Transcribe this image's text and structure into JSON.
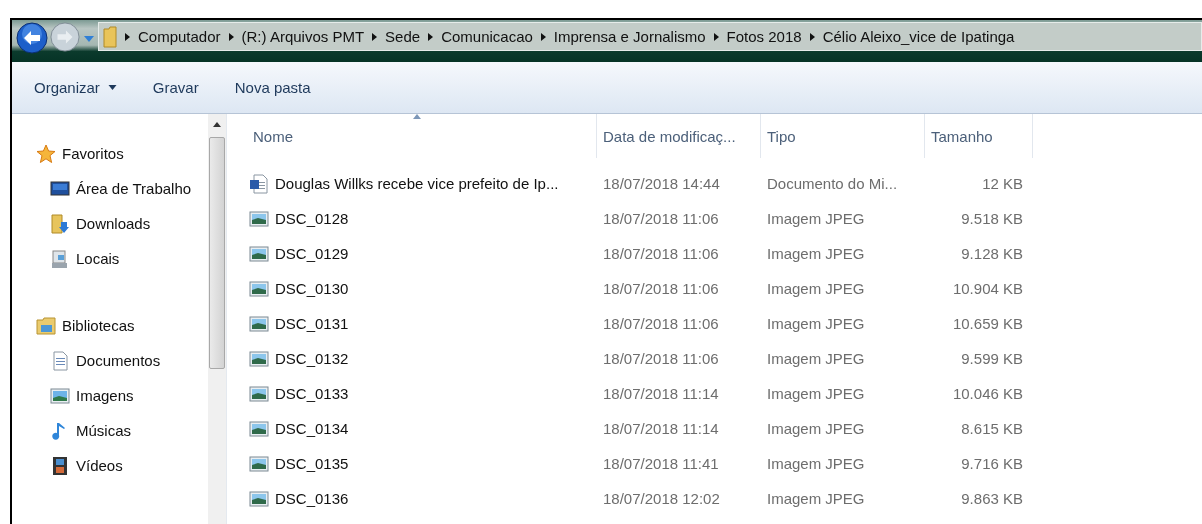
{
  "breadcrumb": [
    "Computador",
    "(R:) Arquivos  PMT",
    "Sede",
    "Comunicacao",
    "Imprensa e Jornalismo",
    "Fotos 2018",
    "Célio Aleixo_vice de Ipatinga"
  ],
  "toolbar": [
    {
      "label": "Organizar",
      "dropdown": true
    },
    {
      "label": "Gravar",
      "dropdown": false
    },
    {
      "label": "Nova pasta",
      "dropdown": false
    }
  ],
  "sidebar": [
    {
      "label": "Favoritos",
      "kind": "star",
      "children": [
        {
          "label": "Área de Trabalho",
          "kind": "desktop"
        },
        {
          "label": "Downloads",
          "kind": "downloads"
        },
        {
          "label": "Locais",
          "kind": "places"
        }
      ]
    },
    {
      "label": "Bibliotecas",
      "kind": "library",
      "children": [
        {
          "label": "Documentos",
          "kind": "documents"
        },
        {
          "label": "Imagens",
          "kind": "images"
        },
        {
          "label": "Músicas",
          "kind": "music"
        },
        {
          "label": "Vídeos",
          "kind": "videos"
        }
      ]
    }
  ],
  "columns": [
    "Nome",
    "Data de modificaç...",
    "Tipo",
    "Tamanho"
  ],
  "rows": [
    {
      "name": "Douglas Willks recebe vice prefeito de Ip...",
      "kind": "word",
      "date": "18/07/2018 14:44",
      "type": "Documento do Mi...",
      "size": "12 KB"
    },
    {
      "name": "DSC_0128",
      "kind": "image",
      "date": "18/07/2018 11:06",
      "type": "Imagem JPEG",
      "size": "9.518 KB"
    },
    {
      "name": "DSC_0129",
      "kind": "image",
      "date": "18/07/2018 11:06",
      "type": "Imagem JPEG",
      "size": "9.128 KB"
    },
    {
      "name": "DSC_0130",
      "kind": "image",
      "date": "18/07/2018 11:06",
      "type": "Imagem JPEG",
      "size": "10.904 KB"
    },
    {
      "name": "DSC_0131",
      "kind": "image",
      "date": "18/07/2018 11:06",
      "type": "Imagem JPEG",
      "size": "10.659 KB"
    },
    {
      "name": "DSC_0132",
      "kind": "image",
      "date": "18/07/2018 11:06",
      "type": "Imagem JPEG",
      "size": "9.599 KB"
    },
    {
      "name": "DSC_0133",
      "kind": "image",
      "date": "18/07/2018 11:14",
      "type": "Imagem JPEG",
      "size": "10.046 KB"
    },
    {
      "name": "DSC_0134",
      "kind": "image",
      "date": "18/07/2018 11:14",
      "type": "Imagem JPEG",
      "size": "8.615 KB"
    },
    {
      "name": "DSC_0135",
      "kind": "image",
      "date": "18/07/2018 11:41",
      "type": "Imagem JPEG",
      "size": "9.716 KB"
    },
    {
      "name": "DSC_0136",
      "kind": "image",
      "date": "18/07/2018 12:02",
      "type": "Imagem JPEG",
      "size": "9.863 KB"
    }
  ]
}
